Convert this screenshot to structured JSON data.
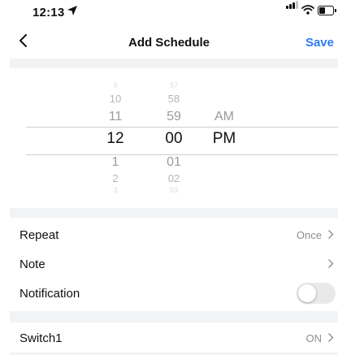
{
  "status_bar": {
    "time": "12:13",
    "battery_level": 0.5
  },
  "nav": {
    "title": "Add Schedule",
    "save_label": "Save"
  },
  "picker": {
    "hours": [
      "9",
      "10",
      "11",
      "12",
      "1",
      "2",
      "3"
    ],
    "minutes": [
      "57",
      "58",
      "59",
      "00",
      "01",
      "02",
      "03"
    ],
    "periods": [
      "AM",
      "PM"
    ],
    "selected": {
      "hour": "12",
      "minute": "00",
      "period": "PM"
    }
  },
  "settings": {
    "repeat": {
      "label": "Repeat",
      "value": "Once"
    },
    "note": {
      "label": "Note"
    },
    "notification": {
      "label": "Notification",
      "enabled": false
    }
  },
  "switch1": {
    "label": "Switch1",
    "value": "ON"
  },
  "colors": {
    "accent": "#2d7bf5",
    "band": "#f2f3f5",
    "toggle_off": "#e9e9ea"
  }
}
